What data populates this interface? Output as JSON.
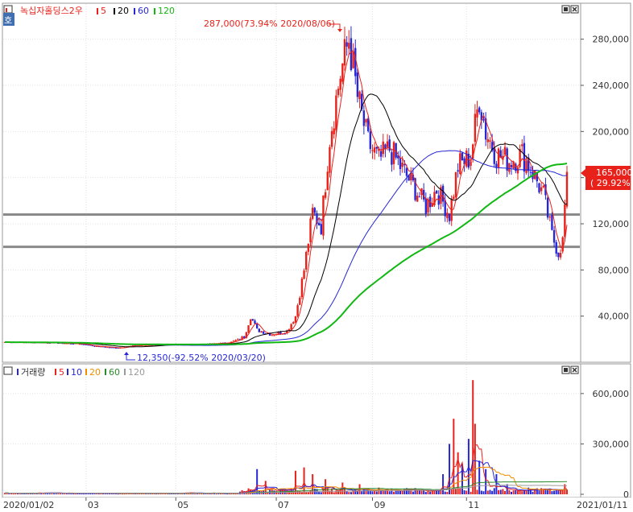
{
  "legend_price": {
    "icon": "chart-icon",
    "name": "녹십자홀딩스2우",
    "mas": [
      {
        "label": "5",
        "color": "#e8221b"
      },
      {
        "label": "20",
        "color": "#000000"
      },
      {
        "label": "60",
        "color": "#2727d6"
      },
      {
        "label": "120",
        "color": "#12b812"
      }
    ]
  },
  "legend_volume": {
    "name": "거래량",
    "mas": [
      {
        "label": "5",
        "color": "#e8221b"
      },
      {
        "label": "10",
        "color": "#2727d6"
      },
      {
        "label": "20",
        "color": "#f08c00"
      },
      {
        "label": "60",
        "color": "#2a8a2a"
      },
      {
        "label": "120",
        "color": "#9a9a9a"
      }
    ]
  },
  "side_tag": "호",
  "annotations": {
    "high": "287,000(73.94% 2020/08/06)",
    "low": "12,350(-92.52% 2020/03/20)"
  },
  "current_price": {
    "value": "165,000",
    "change": "( 29.92%)"
  },
  "x_start": "2020/01/02",
  "x_end": "2021/01/11",
  "x_ticks": [
    "03",
    "05",
    "07",
    "09",
    "11"
  ],
  "price_ticks": [
    "280,000",
    "240,000",
    "200,000",
    "160,000",
    "120,000",
    "80,000",
    "40,000"
  ],
  "volume_ticks": [
    "600,000",
    "300,000",
    "0"
  ],
  "colors": {
    "up": "#e8221b",
    "down": "#2727d6",
    "ma5": "#e8221b",
    "ma20": "#000000",
    "ma60": "#2727d6",
    "ma120": "#12b812",
    "hline": "#8a8a8a",
    "vol_ma20": "#f08c00",
    "vol_ma60": "#2a8a2a",
    "vol_ma120": "#9a9a9a"
  },
  "chart_data": [
    {
      "type": "candlestick",
      "ylim": [
        0,
        300000
      ],
      "ticks": [
        40000,
        80000,
        120000,
        160000,
        200000,
        240000,
        280000
      ],
      "hlines": [
        128000,
        100000
      ],
      "high": 287000,
      "low": 12350,
      "current": 165000,
      "months": [
        "2020/01",
        "2020/02",
        "2020/03",
        "2020/04",
        "2020/05",
        "2020/06",
        "2020/07",
        "2020/08",
        "2020/09",
        "2020/10",
        "2020/11",
        "2020/12",
        "2021/01"
      ],
      "anchors": [
        [
          0,
          17500
        ],
        [
          20,
          17000
        ],
        [
          35,
          16000
        ],
        [
          42,
          14000
        ],
        [
          53,
          12350
        ],
        [
          60,
          14500
        ],
        [
          75,
          15200
        ],
        [
          95,
          15800
        ],
        [
          105,
          17000
        ],
        [
          112,
          22000
        ],
        [
          115,
          40000
        ],
        [
          118,
          28000
        ],
        [
          125,
          24000
        ],
        [
          132,
          27000
        ],
        [
          136,
          40000
        ],
        [
          140,
          80000
        ],
        [
          144,
          130000
        ],
        [
          148,
          118000
        ],
        [
          152,
          195000
        ],
        [
          157,
          250000
        ],
        [
          161,
          280000
        ],
        [
          165,
          230000
        ],
        [
          170,
          190000
        ],
        [
          175,
          175000
        ],
        [
          180,
          185000
        ],
        [
          185,
          170000
        ],
        [
          192,
          150000
        ],
        [
          197,
          135000
        ],
        [
          202,
          150000
        ],
        [
          208,
          128000
        ],
        [
          212,
          170000
        ],
        [
          218,
          178000
        ],
        [
          222,
          230000
        ],
        [
          225,
          200000
        ],
        [
          230,
          180000
        ],
        [
          236,
          175000
        ],
        [
          242,
          180000
        ],
        [
          247,
          165000
        ],
        [
          252,
          145000
        ],
        [
          256,
          110000
        ],
        [
          259,
          95000
        ],
        [
          261,
          105000
        ],
        [
          263,
          165000
        ]
      ]
    },
    {
      "type": "bar",
      "ylim": [
        0,
        700000
      ],
      "ticks": [
        0,
        300000,
        600000
      ],
      "spikes": [
        [
          118,
          150000
        ],
        [
          122,
          80000
        ],
        [
          136,
          140000
        ],
        [
          140,
          160000
        ],
        [
          144,
          120000
        ],
        [
          150,
          90000
        ],
        [
          158,
          70000
        ],
        [
          166,
          60000
        ],
        [
          175,
          40000
        ],
        [
          205,
          120000
        ],
        [
          208,
          300000
        ],
        [
          210,
          450000
        ],
        [
          212,
          250000
        ],
        [
          214,
          180000
        ],
        [
          217,
          330000
        ],
        [
          219,
          680000
        ],
        [
          220,
          420000
        ],
        [
          222,
          200000
        ],
        [
          225,
          150000
        ],
        [
          230,
          120000
        ],
        [
          235,
          60000
        ],
        [
          245,
          40000
        ],
        [
          252,
          30000
        ],
        [
          260,
          25000
        ],
        [
          262,
          60000
        ]
      ]
    }
  ]
}
